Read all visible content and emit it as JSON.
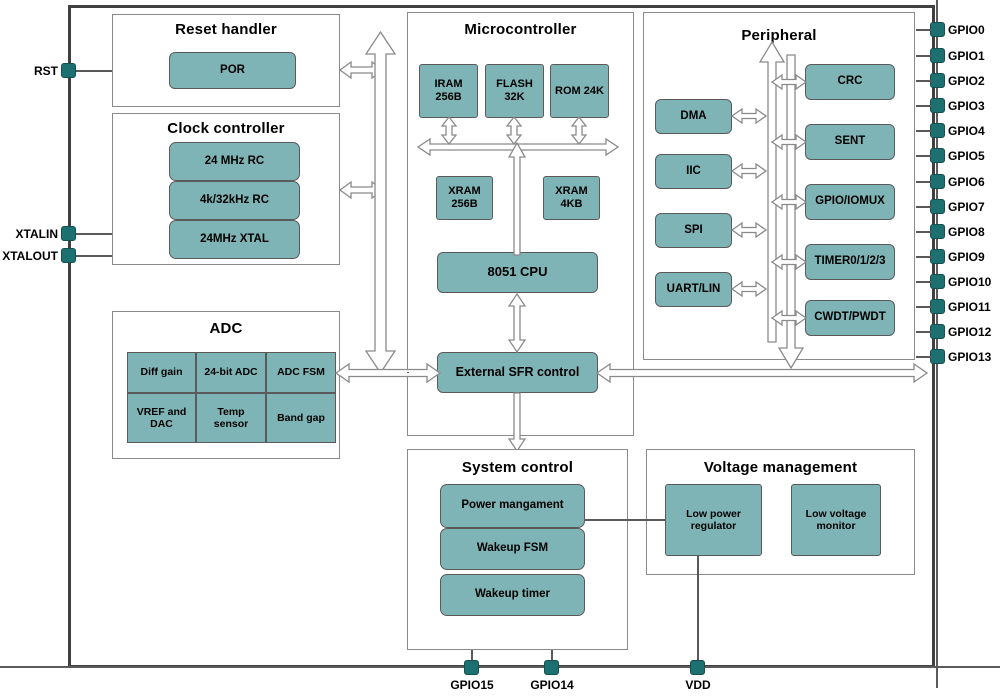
{
  "diagram": {
    "title": "Microcontroller block diagram",
    "colors": {
      "block_fill": "#7FB4B6",
      "block_stroke": "#5A5A5A",
      "pin_fill": "#1D7070",
      "chip_border": "#404040",
      "group_border": "#8A8A8A",
      "arrow_stroke": "#8A8A8A",
      "background": "#FFFFFF"
    },
    "groups": {
      "reset_handler": {
        "title": "Reset handler",
        "blocks": [
          {
            "label": "POR"
          }
        ]
      },
      "clock_controller": {
        "title": "Clock controller",
        "blocks": [
          {
            "label": "24 MHz RC"
          },
          {
            "label": "4k/32kHz RC"
          },
          {
            "label": "24MHz XTAL"
          }
        ]
      },
      "adc": {
        "title": "ADC",
        "blocks": [
          {
            "label": "Diff gain"
          },
          {
            "label": "24-bit ADC"
          },
          {
            "label": "ADC FSM"
          },
          {
            "label": "VREF and DAC"
          },
          {
            "label": "Temp sensor"
          },
          {
            "label": "Band gap"
          }
        ]
      },
      "microcontroller": {
        "title": "Microcontroller",
        "blocks": [
          {
            "label": "IRAM 256B"
          },
          {
            "label": "FLASH 32K"
          },
          {
            "label": "ROM 24K"
          },
          {
            "label": "XRAM 256B"
          },
          {
            "label": "XRAM 4KB"
          },
          {
            "label": "8051 CPU"
          },
          {
            "label": "External SFR control"
          }
        ]
      },
      "peripheral": {
        "title": "Peripheral",
        "blocks_left": [
          {
            "label": "DMA"
          },
          {
            "label": "IIC"
          },
          {
            "label": "SPI"
          },
          {
            "label": "UART/LIN"
          }
        ],
        "blocks_right": [
          {
            "label": "CRC"
          },
          {
            "label": "SENT"
          },
          {
            "label": "GPIO/IOMUX"
          },
          {
            "label": "TIMER0/1/2/3"
          },
          {
            "label": "CWDT/PWDT"
          }
        ]
      },
      "system_control": {
        "title": "System control",
        "blocks": [
          {
            "label": "Power mangament"
          },
          {
            "label": "Wakeup FSM"
          },
          {
            "label": "Wakeup timer"
          }
        ]
      },
      "voltage_management": {
        "title": "Voltage management",
        "blocks": [
          {
            "label": "Low power regulator"
          },
          {
            "label": "Low voltage monitor"
          }
        ]
      }
    },
    "pins": {
      "left": [
        {
          "label": "RST"
        },
        {
          "label": "XTALIN"
        },
        {
          "label": "XTALOUT"
        }
      ],
      "right": [
        {
          "label": "GPIO0"
        },
        {
          "label": "GPIO1"
        },
        {
          "label": "GPIO2"
        },
        {
          "label": "GPIO3"
        },
        {
          "label": "GPIO4"
        },
        {
          "label": "GPIO5"
        },
        {
          "label": "GPIO6"
        },
        {
          "label": "GPIO7"
        },
        {
          "label": "GPIO8"
        },
        {
          "label": "GPIO9"
        },
        {
          "label": "GPIO10"
        },
        {
          "label": "GPIO11"
        },
        {
          "label": "GPIO12"
        },
        {
          "label": "GPIO13"
        }
      ],
      "bottom": [
        {
          "label": "GPIO15"
        },
        {
          "label": "GPIO14"
        },
        {
          "label": "VDD"
        }
      ]
    }
  }
}
